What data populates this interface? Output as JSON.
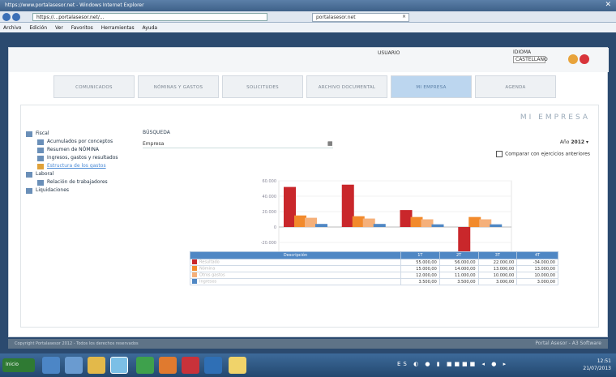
{
  "browser": {
    "title": "https://www.portalasesor.net - Windows Internet Explorer",
    "url": "https://...portalasesor.net/...",
    "tab_label": "portalasesor.net",
    "menu": [
      "Archivo",
      "Edición",
      "Ver",
      "Favoritos",
      "Herramientas",
      "Ayuda"
    ]
  },
  "header": {
    "user_label": "USUARIO",
    "lang_label": "IDIOMA",
    "lang_value": "CASTELLANO"
  },
  "tabs": [
    "COMUNICADOS",
    "NÓMINAS Y GASTOS",
    "SOLICITUDES",
    "ARCHIVO DOCUMENTAL",
    "MI EMPRESA",
    "AGENDA"
  ],
  "active_tab": 4,
  "page_title": "MI EMPRESA",
  "sidebar": {
    "groups": [
      {
        "label": "Fiscal",
        "items": [
          "Acumulados por conceptos",
          "Resumen de NÓMINA",
          "Ingresos, gastos y resultados",
          "Estructura de los gastos"
        ]
      },
      {
        "label": "Laboral",
        "items": [
          "Relación de trabajadores",
          "Liquidaciones"
        ]
      }
    ]
  },
  "search": {
    "label": "BÚSQUEDA",
    "field_label": "Empresa"
  },
  "year": {
    "label": "Año",
    "value": "2012"
  },
  "compare_label": "Comparar con ejercicios anteriores",
  "chart_data": {
    "type": "bar",
    "categories": [
      "1T",
      "2T",
      "3T",
      "4T"
    ],
    "ylim": [
      -40000,
      60000
    ],
    "yticks": [
      "60.000",
      "40.000",
      "20.000",
      "0",
      "-20.000",
      "-40.000"
    ],
    "series": [
      {
        "color": "#c9272b",
        "values": [
          52000,
          55000,
          22000,
          -33000
        ]
      },
      {
        "color": "#f28a2c",
        "values": [
          15000,
          14000,
          13000,
          13000
        ]
      },
      {
        "color": "#f5b07a",
        "values": [
          12000,
          11000,
          10000,
          10000
        ]
      },
      {
        "color": "#4f87c4",
        "values": [
          4000,
          4000,
          3500,
          3500
        ]
      }
    ]
  },
  "table": {
    "header": [
      "Descripción",
      "1T",
      "2T",
      "3T",
      "4T"
    ],
    "rows": [
      {
        "color": "#c9272b",
        "cells": [
          "Resultado",
          "55.000,00",
          "56.000,00",
          "22.000,00",
          "-34.000,00"
        ]
      },
      {
        "color": "#f28a2c",
        "cells": [
          "Nómina",
          "15.000,00",
          "14.000,00",
          "13.000,00",
          "13.000,00"
        ]
      },
      {
        "color": "#f5b07a",
        "cells": [
          "Otros gastos",
          "12.000,00",
          "11.000,00",
          "10.000,00",
          "10.000,00"
        ]
      },
      {
        "color": "#4f87c4",
        "cells": [
          "Ingresos",
          "3.500,00",
          "3.500,00",
          "3.000,00",
          "3.000,00"
        ]
      }
    ]
  },
  "footer": {
    "left": "Copyright Portalasesor 2012 - Todos los derechos reservados",
    "right": "Portal Asesor - A3 Software"
  },
  "clock": {
    "time": "12:51",
    "date": "21/07/2013"
  },
  "taskbar": {
    "start_label": "Inicio"
  }
}
